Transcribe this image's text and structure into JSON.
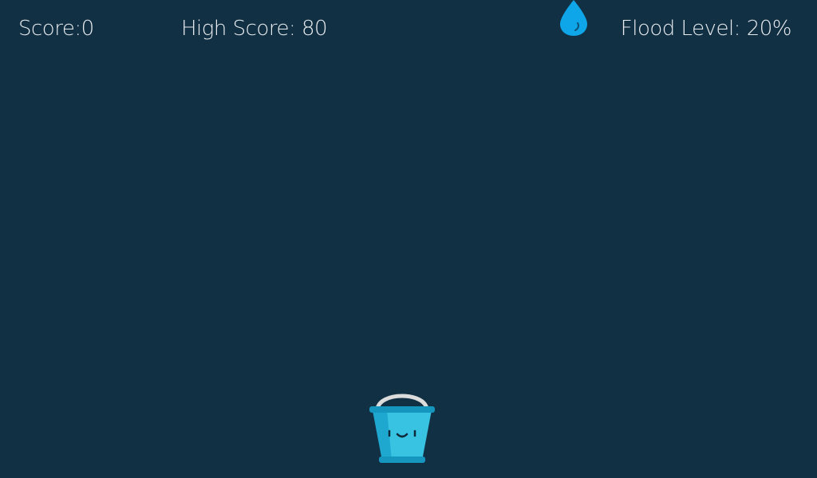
{
  "hud": {
    "score_label": "Score:",
    "score_value": "0",
    "high_score_label": "High Score:",
    "high_score_value": "80",
    "flood_label": "Flood Level:",
    "flood_value": "20%"
  },
  "game": {
    "background_color": "#123044",
    "raindrop_color": "#0ea5e9",
    "bucket_color": "#38c3e3",
    "bucket_rim_color": "#1496bf",
    "handle_color": "#dcdcdc",
    "icons": [
      "raindrop-icon",
      "bucket-player"
    ]
  }
}
